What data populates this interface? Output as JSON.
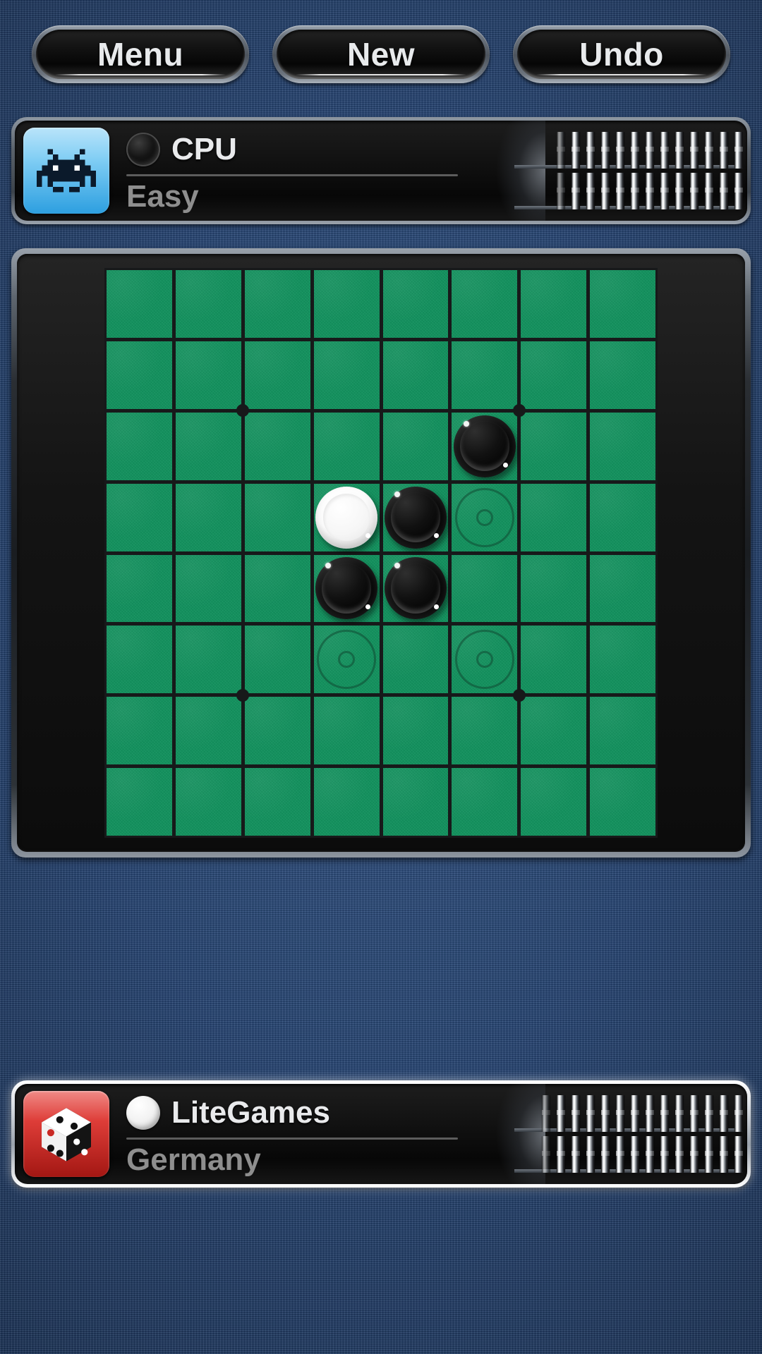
{
  "toolbar": {
    "buttons": [
      {
        "label": "Menu",
        "name": "menu-button"
      },
      {
        "label": "New",
        "name": "new-game-button"
      },
      {
        "label": "Undo",
        "name": "undo-button"
      }
    ]
  },
  "players": {
    "top": {
      "name": "CPU",
      "subtitle": "Easy",
      "disc_color": "black",
      "avatar_icon": "space-invader-icon",
      "avatar_bg": "#2d9fe0",
      "score_chips_row1": 13,
      "score_chips_row2": 13
    },
    "bottom": {
      "name": "LiteGames",
      "subtitle": "Germany",
      "disc_color": "white",
      "avatar_icon": "dice-icon",
      "avatar_bg": "#de3d38",
      "score_chips_row1": 14,
      "score_chips_row2": 14,
      "active": true
    }
  },
  "board": {
    "columns": 8,
    "rows": 8,
    "felt_color": "#13935f",
    "grid_line_color": "#17191a",
    "star_points": [
      {
        "col": 2,
        "row": 2
      },
      {
        "col": 6,
        "row": 2
      },
      {
        "col": 2,
        "row": 6
      },
      {
        "col": 6,
        "row": 6
      }
    ],
    "cells": [
      {
        "col": 5,
        "row": 2,
        "state": "black"
      },
      {
        "col": 3,
        "row": 3,
        "state": "white"
      },
      {
        "col": 4,
        "row": 3,
        "state": "black"
      },
      {
        "col": 5,
        "row": 3,
        "state": "hint"
      },
      {
        "col": 3,
        "row": 4,
        "state": "black"
      },
      {
        "col": 4,
        "row": 4,
        "state": "black"
      },
      {
        "col": 3,
        "row": 5,
        "state": "hint"
      },
      {
        "col": 5,
        "row": 5,
        "state": "hint"
      }
    ]
  }
}
